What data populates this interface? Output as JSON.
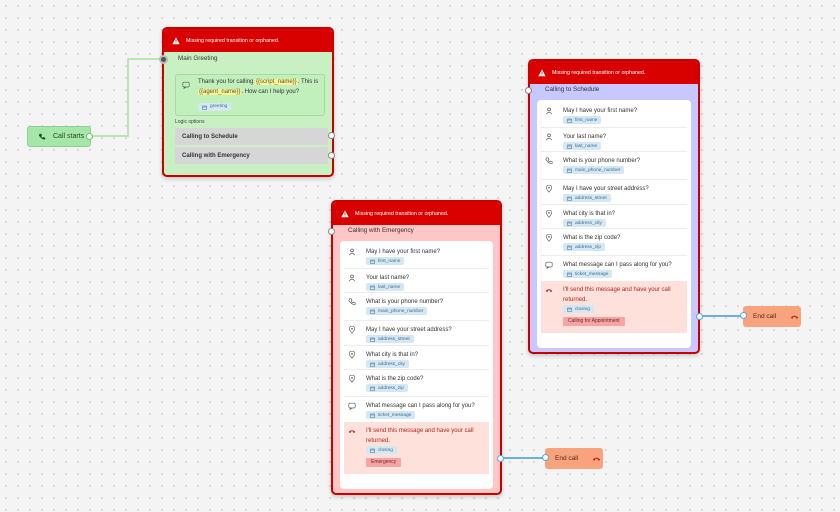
{
  "start": {
    "label": "Call starts"
  },
  "main": {
    "warning": "Missing required transition or orphaned.",
    "title": "Main Greeting",
    "greeting_pre": "Thank you for calling",
    "var1": "{{script_name}}",
    "greeting_mid": ". This is",
    "var2": "{{agent_name}}",
    "greeting_post": ". How can I help you?",
    "tag": "greeting",
    "logic_label": "Logic options",
    "options": [
      "Calling to Schedule",
      "Calling with Emergency"
    ]
  },
  "emergency": {
    "warning": "Missing required transition or orphaned.",
    "title": "Calling with Emergency",
    "steps": [
      {
        "text": "May I have your first name?",
        "tag": "first_name",
        "icon": "person-icon"
      },
      {
        "text": "Your last name?",
        "tag": "last_name",
        "icon": "person-icon"
      },
      {
        "text": "What is your phone number?",
        "tag": "main_phone_number",
        "icon": "phone-icon"
      },
      {
        "text": "May I have your street address?",
        "tag": "address_street",
        "icon": "location-icon"
      },
      {
        "text": "What city is that in?",
        "tag": "address_city",
        "icon": "location-icon"
      },
      {
        "text": "What is the zip code?",
        "tag": "address_zip",
        "icon": "location-icon"
      },
      {
        "text": "What message can I pass along for you?",
        "tag": "ticket_message",
        "icon": "message-icon"
      }
    ],
    "closing": {
      "text": "I'll send this message and have your call returned.",
      "tag": "closing",
      "outcome": "Emergency"
    }
  },
  "schedule": {
    "warning": "Missing required transition or orphaned.",
    "title": "Calling to Schedule",
    "steps": [
      {
        "text": "May I have your first name?",
        "tag": "first_name",
        "icon": "person-icon"
      },
      {
        "text": "Your last name?",
        "tag": "last_name",
        "icon": "person-icon"
      },
      {
        "text": "What is your phone number?",
        "tag": "main_phone_number",
        "icon": "phone-icon"
      },
      {
        "text": "May I have your street address?",
        "tag": "address_street",
        "icon": "location-icon"
      },
      {
        "text": "What city is that in?",
        "tag": "address_city",
        "icon": "location-icon"
      },
      {
        "text": "What is the zip code?",
        "tag": "address_zip",
        "icon": "location-icon"
      },
      {
        "text": "What message can I pass along for you?",
        "tag": "ticket_message",
        "icon": "message-icon"
      }
    ],
    "closing": {
      "text": "I'll send this message and have your call returned.",
      "tag": "closing",
      "outcome": "Calling for Appointment"
    }
  },
  "end_nodes": [
    {
      "label": "End call"
    },
    {
      "label": "End call"
    }
  ],
  "colors": {
    "warning": "#d90000",
    "greeting_bg": "#c9f0c2",
    "emergency_bg": "#ffc6c6",
    "schedule_bg": "#c6c8ff",
    "end_node": "#f8a37d",
    "start_node": "#a6e6a8",
    "edge_blue": "#3a9bd1",
    "edge_green": "#a8e0a0"
  }
}
